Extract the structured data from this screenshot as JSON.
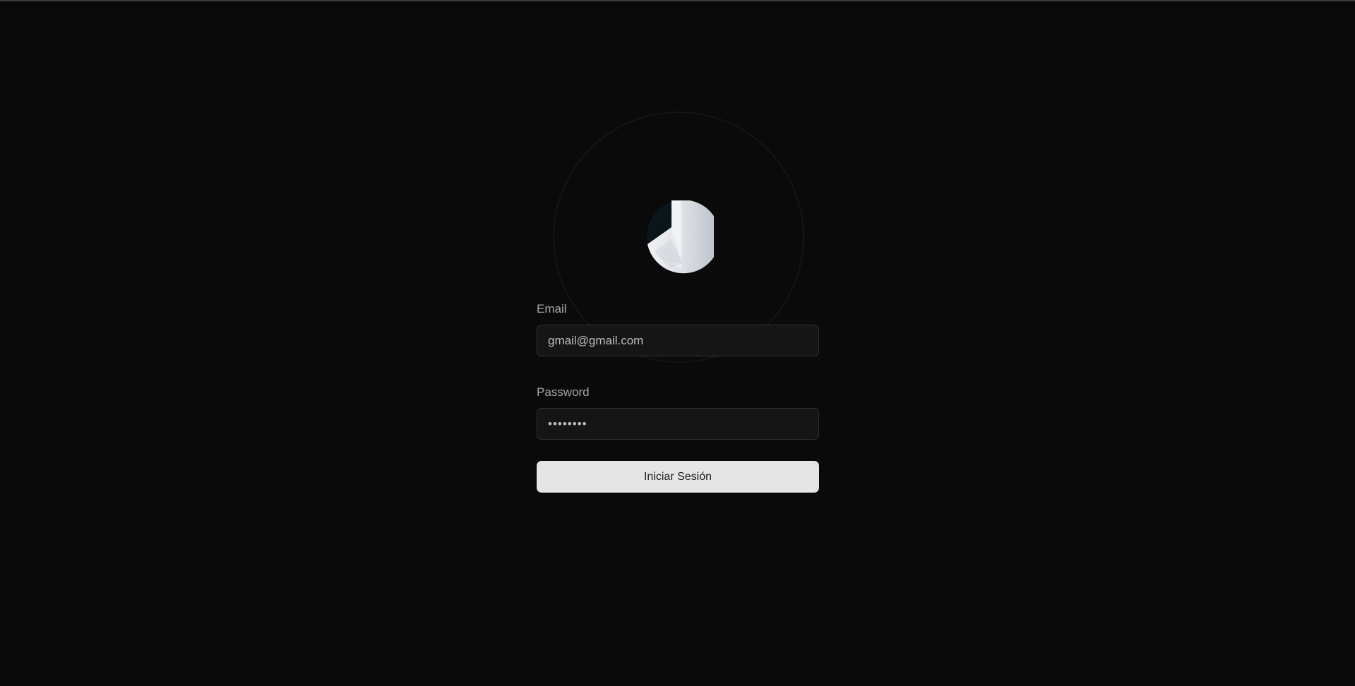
{
  "login": {
    "email_label": "Email",
    "email_value": "gmail@gmail.com",
    "password_label": "Password",
    "password_value": "••••••••",
    "submit_label": "Iniciar Sesión"
  },
  "icons": {
    "logo": "pie-chart-logo-icon"
  },
  "colors": {
    "background": "#0a0a0a",
    "field_background": "#151515",
    "field_border": "#333333",
    "button_background": "#e5e5e5",
    "button_text": "#1a1a1a",
    "label_text": "#a6a6a6"
  }
}
